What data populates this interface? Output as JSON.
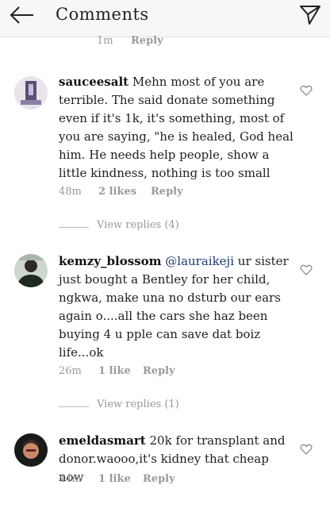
{
  "header": {
    "title": "Comments"
  },
  "top_meta": {
    "time": "1m",
    "reply": "Reply"
  },
  "comments": [
    {
      "username": "sauceesalt",
      "mention": "",
      "text": "Mehn most of you are terrible. The said donate something even if it's 1k, it's something, most of you are saying, \"he is healed, God heal him. He needs help people, show a little kindness, nothing is too small",
      "time": "48m",
      "likes": "2 likes",
      "reply": "Reply",
      "view_replies": "View replies (4)"
    },
    {
      "username": "kemzy_blossom",
      "mention": "@lauraikeji",
      "text": "ur sister just bought a Bentley for her child, ngkwa, make una no dsturb our ears again o....all the cars she haz been buying 4 u pple can save dat boiz life...ok",
      "time": "26m",
      "likes": "1 like",
      "reply": "Reply",
      "view_replies": "View replies (1)"
    },
    {
      "username": "emeldasmart",
      "mention": "",
      "text": "20k for transplant and donor.waooo,it's kidney that cheap now",
      "time": "44m",
      "likes": "1 like",
      "reply": "Reply",
      "view_replies": ""
    }
  ],
  "icons": {
    "back": "back-arrow-icon",
    "send": "send-icon",
    "like": "heart-icon"
  },
  "colors": {
    "header_bg": "#f7f7f7",
    "meta_text": "#999999",
    "mention": "#1e3a6b"
  }
}
